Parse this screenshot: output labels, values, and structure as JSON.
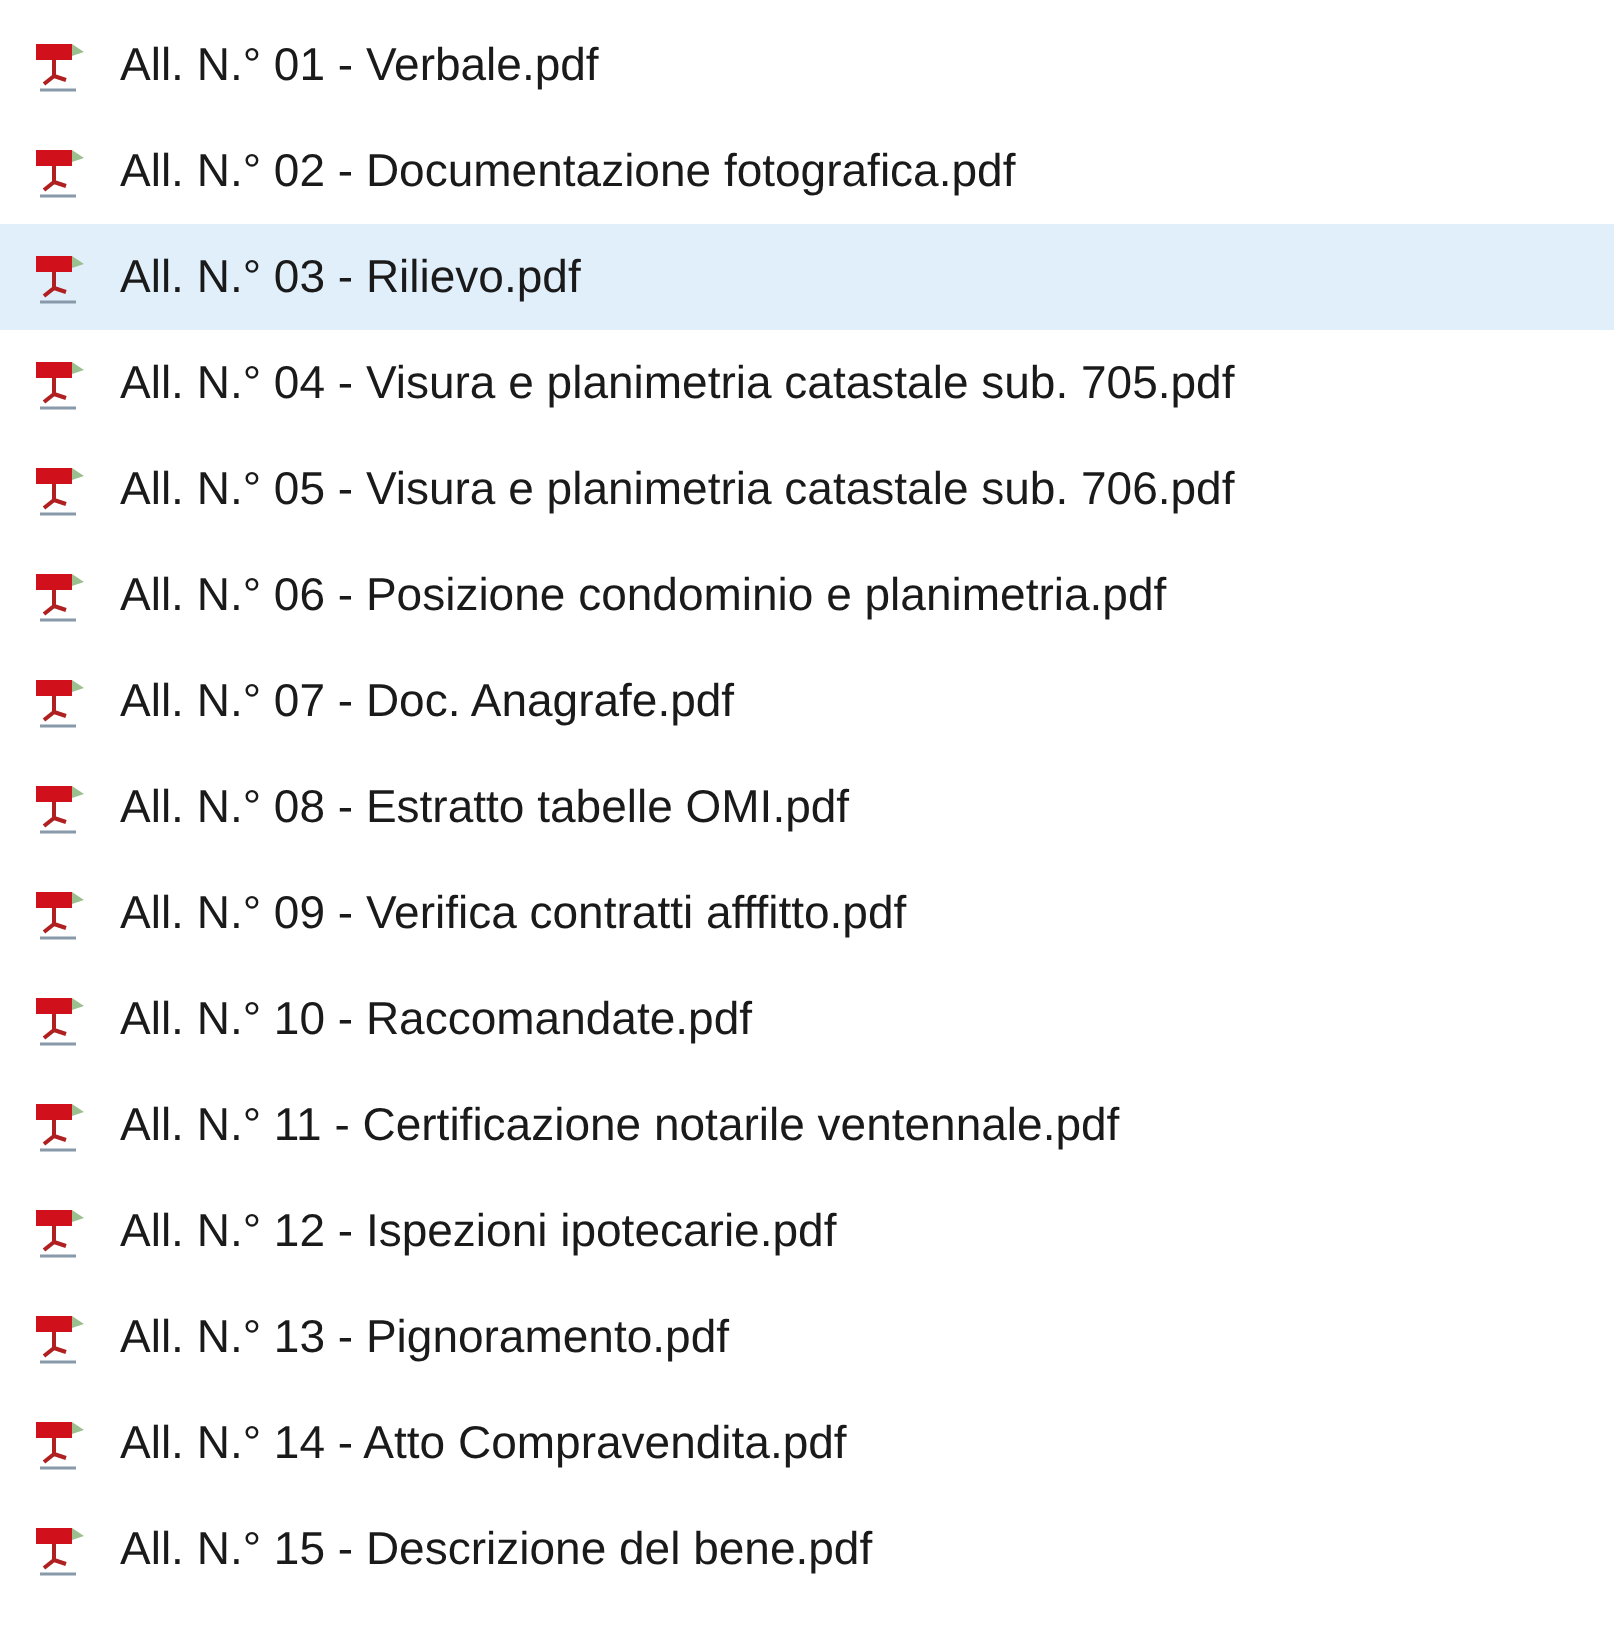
{
  "files": [
    {
      "name": "All. N.° 01 - Verbale.pdf",
      "selected": false
    },
    {
      "name": "All. N.° 02 - Documentazione fotografica.pdf",
      "selected": false
    },
    {
      "name": "All. N.° 03 - Rilievo.pdf",
      "selected": true
    },
    {
      "name": "All. N.° 04 - Visura e planimetria catastale sub. 705.pdf",
      "selected": false
    },
    {
      "name": "All. N.° 05 - Visura e planimetria catastale sub. 706.pdf",
      "selected": false
    },
    {
      "name": "All. N.° 06 - Posizione condominio e planimetria.pdf",
      "selected": false
    },
    {
      "name": "All. N.° 07 - Doc. Anagrafe.pdf",
      "selected": false
    },
    {
      "name": "All. N.° 08 - Estratto tabelle OMI.pdf",
      "selected": false
    },
    {
      "name": "All. N.° 09 - Verifica contratti afffitto.pdf",
      "selected": false
    },
    {
      "name": "All. N.° 10 - Raccomandate.pdf",
      "selected": false
    },
    {
      "name": "All. N.° 11 - Certificazione notarile ventennale.pdf",
      "selected": false
    },
    {
      "name": "All. N.° 12 - Ispezioni ipotecarie.pdf",
      "selected": false
    },
    {
      "name": "All. N.° 13 - Pignoramento.pdf",
      "selected": false
    },
    {
      "name": "All. N.° 14 - Atto Compravendita.pdf",
      "selected": false
    },
    {
      "name": "All. N.° 15 - Descrizione del bene.pdf",
      "selected": false
    }
  ]
}
